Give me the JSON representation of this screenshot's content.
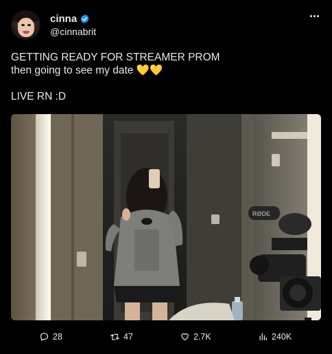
{
  "author": {
    "display_name": "cinna",
    "handle": "@cinnabrit",
    "verified_color": "#1d9bf0"
  },
  "tweet": {
    "text": "GETTING READY FOR STREAMER PROM\nthen going to see my date 💛💛\n\nLIVE RN :D",
    "media_description_icon": "photo"
  },
  "menu": {
    "icon": "more-horizontal-icon"
  },
  "stats": {
    "replies": "28",
    "retweets": "47",
    "likes": "2.7K",
    "views": "240K"
  },
  "colors": {
    "background": "#000000",
    "text": "#e7e9ea",
    "accent": "#1d9bf0"
  }
}
